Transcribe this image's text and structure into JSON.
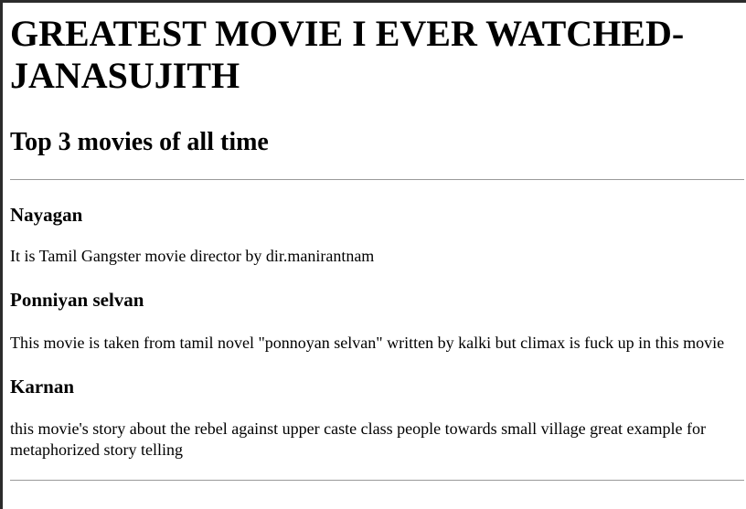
{
  "page": {
    "title": "GREATEST MOVIE I EVER WATCHED-JANASUJITH",
    "subtitle": "Top 3 movies of all time"
  },
  "movies": [
    {
      "name": "Nayagan",
      "description": "It is Tamil Gangster movie director by dir.manirantnam"
    },
    {
      "name": "Ponniyan selvan",
      "description": "This movie is taken from tamil novel \"ponnoyan selvan\" written by kalki but climax is fuck up in this movie"
    },
    {
      "name": "Karnan",
      "description": "this movie's story about the rebel against upper caste class people towards small village great example for metaphorized story telling"
    }
  ]
}
